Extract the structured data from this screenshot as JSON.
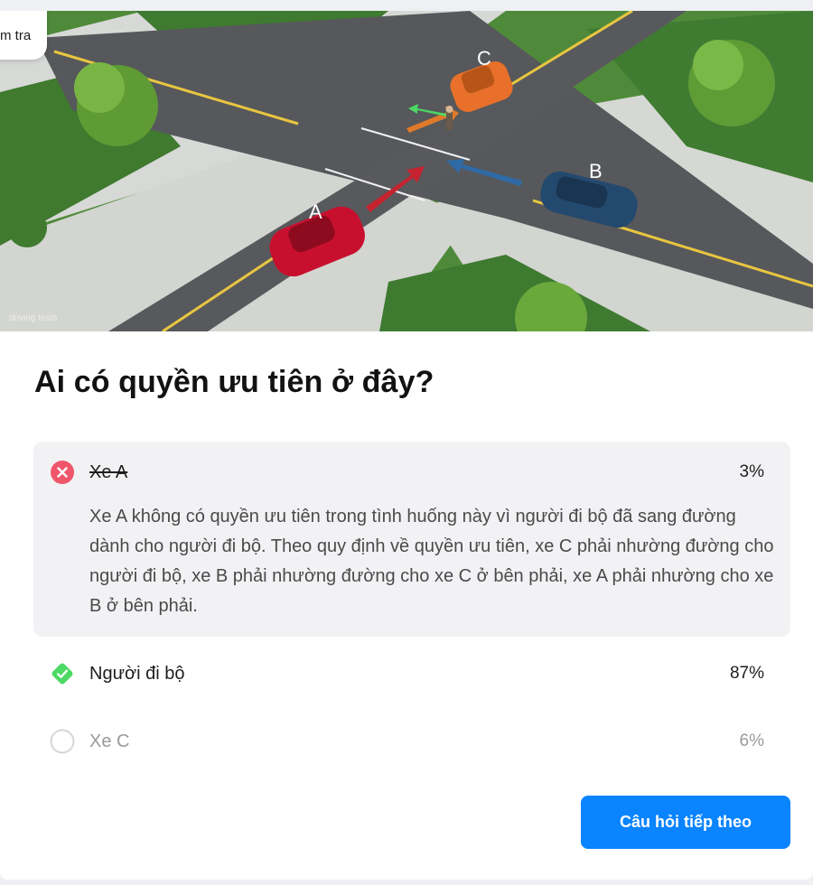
{
  "header": {
    "tag_label": "m tra"
  },
  "image": {
    "car_labels": [
      "A",
      "B",
      "C"
    ],
    "watermark": "driving tests"
  },
  "question": {
    "text": "Ai có quyền ưu tiên ở đây?"
  },
  "options": [
    {
      "label": "Xe A",
      "percent": "3%",
      "state": "wrong",
      "explanation": "Xe A không có quyền ưu tiên trong tình huống này vì người đi bộ đã sang đường dành cho người đi bộ. Theo quy định về quyền ưu tiên, xe C phải nhường đường cho người đi bộ, xe B phải nhường đường cho xe C ở bên phải, xe A phải nhường cho xe B ở bên phải."
    },
    {
      "label": "Người đi bộ",
      "percent": "87%",
      "state": "correct"
    },
    {
      "label": "Xe C",
      "percent": "6%",
      "state": "unselected"
    }
  ],
  "actions": {
    "next_label": "Câu hỏi tiếp theo"
  },
  "colors": {
    "accent": "#0a84ff",
    "wrong": "#f0566a",
    "correct": "#4cd964",
    "car_a": "#c8102e",
    "car_b": "#24496e",
    "car_c": "#e8702a"
  }
}
